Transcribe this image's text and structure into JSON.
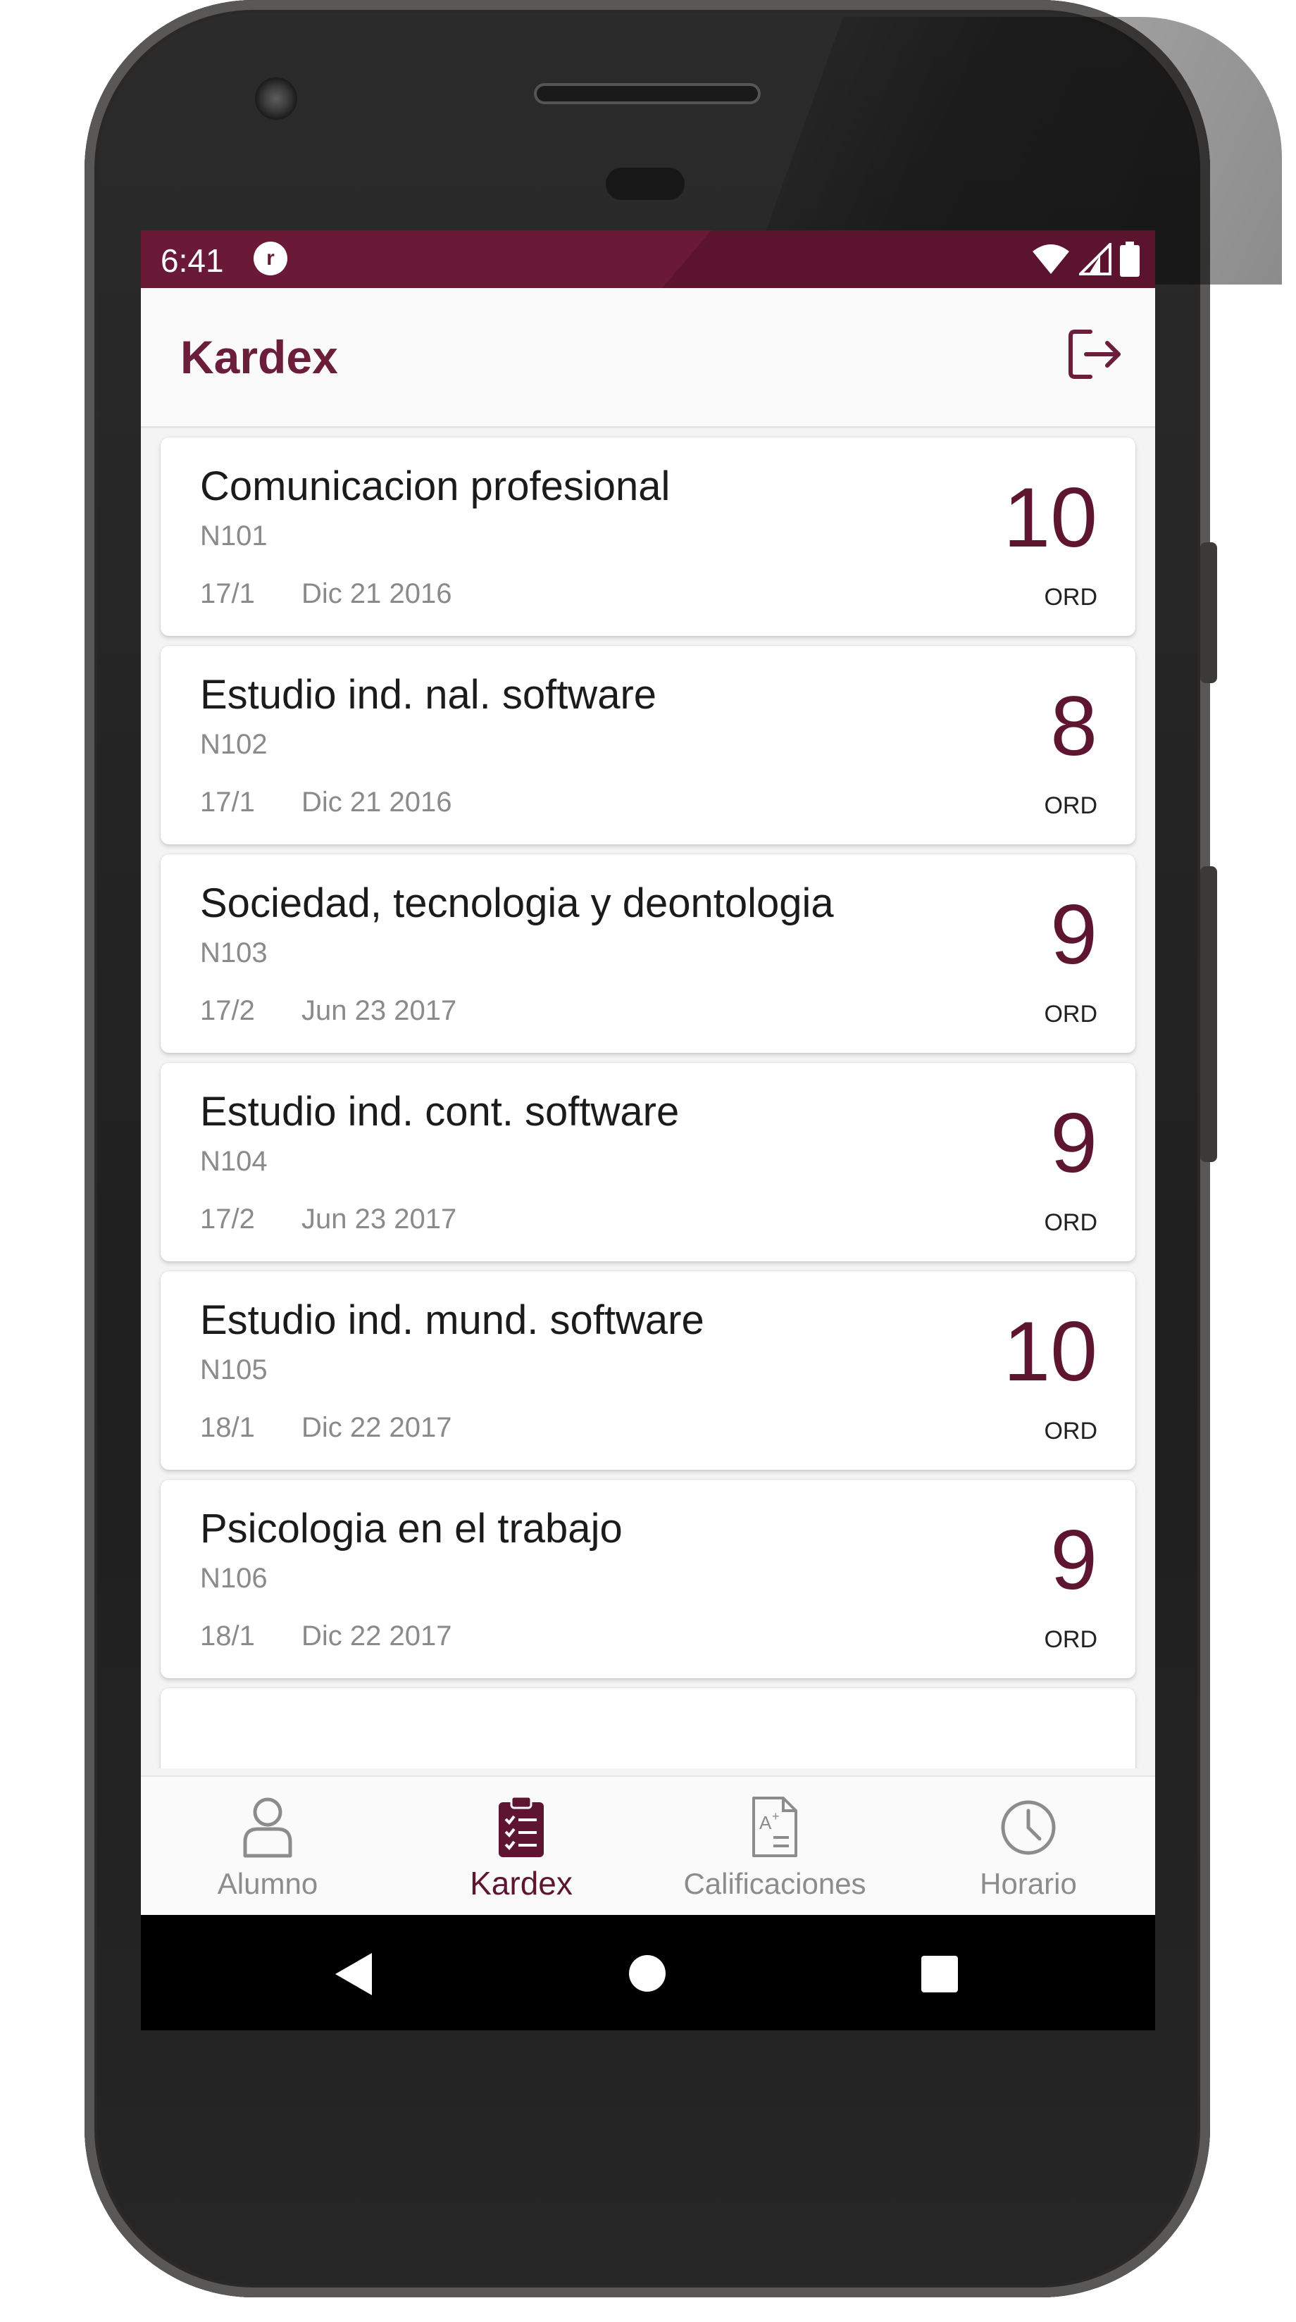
{
  "status_bar": {
    "time": "6:41",
    "notification_icon": "ring-notification-icon"
  },
  "app_bar": {
    "title": "Kardex",
    "action_icon": "logout-icon"
  },
  "courses": [
    {
      "name": "Comunicacion profesional",
      "code": "N101",
      "period": "17/1",
      "date": "Dic 21 2016",
      "grade": "10",
      "type": "ORD"
    },
    {
      "name": "Estudio ind. nal. software",
      "code": "N102",
      "period": "17/1",
      "date": "Dic 21 2016",
      "grade": "8",
      "type": "ORD"
    },
    {
      "name": "Sociedad, tecnologia y deontologia",
      "code": "N103",
      "period": "17/2",
      "date": "Jun 23 2017",
      "grade": "9",
      "type": "ORD"
    },
    {
      "name": "Estudio ind. cont. software",
      "code": "N104",
      "period": "17/2",
      "date": "Jun 23 2017",
      "grade": "9",
      "type": "ORD"
    },
    {
      "name": "Estudio ind. mund. software",
      "code": "N105",
      "period": "18/1",
      "date": "Dic 22 2017",
      "grade": "10",
      "type": "ORD"
    },
    {
      "name": "Psicologia en el trabajo",
      "code": "N106",
      "period": "18/1",
      "date": "Dic 22 2017",
      "grade": "9",
      "type": "ORD"
    }
  ],
  "bottom_nav": [
    {
      "label": "Alumno",
      "icon": "person-icon",
      "active": false
    },
    {
      "label": "Kardex",
      "icon": "clipboard-checklist-icon",
      "active": true
    },
    {
      "label": "Calificaciones",
      "icon": "graded-document-icon",
      "active": false
    },
    {
      "label": "Horario",
      "icon": "clock-icon",
      "active": false
    }
  ],
  "colors": {
    "primary": "#6a1a36",
    "grade": "#5e1530",
    "muted": "#8a8a8a"
  }
}
